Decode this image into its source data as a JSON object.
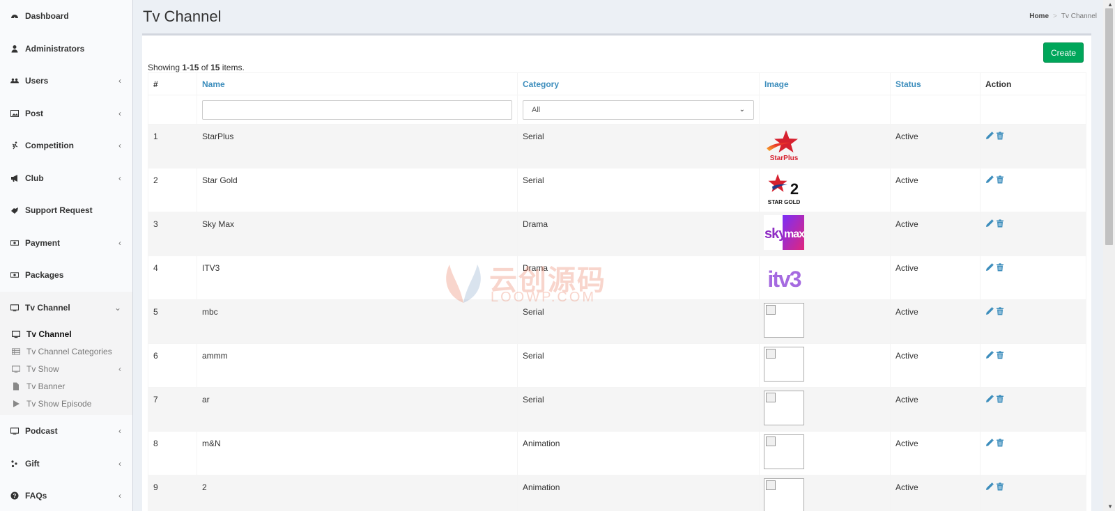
{
  "sidebar": {
    "items": [
      {
        "label": "Dashboard",
        "icon": "dashboard-icon",
        "chevron": ""
      },
      {
        "label": "Administrators",
        "icon": "user-icon",
        "chevron": ""
      },
      {
        "label": "Users",
        "icon": "users-icon",
        "chevron": "‹"
      },
      {
        "label": "Post",
        "icon": "picture-icon",
        "chevron": "‹"
      },
      {
        "label": "Competition",
        "icon": "running-icon",
        "chevron": "‹"
      },
      {
        "label": "Club",
        "icon": "bullhorn-icon",
        "chevron": "‹"
      },
      {
        "label": "Support Request",
        "icon": "handshake-icon",
        "chevron": ""
      },
      {
        "label": "Payment",
        "icon": "money-icon",
        "chevron": "‹"
      },
      {
        "label": "Packages",
        "icon": "money-icon",
        "chevron": ""
      },
      {
        "label": "Tv Channel",
        "icon": "tv-icon",
        "chevron": "⌄"
      },
      {
        "label": "Podcast",
        "icon": "tv-icon",
        "chevron": "‹"
      },
      {
        "label": "Gift",
        "icon": "gift-icon",
        "chevron": "‹"
      },
      {
        "label": "FAQs",
        "icon": "question-icon",
        "chevron": "‹"
      }
    ],
    "tv_submenu": [
      {
        "label": "Tv Channel",
        "icon": "tv-icon"
      },
      {
        "label": "Tv Channel Categories",
        "icon": "list-icon"
      },
      {
        "label": "Tv Show",
        "icon": "tv-icon",
        "chevron": "‹"
      },
      {
        "label": "Tv Banner",
        "icon": "file-icon"
      },
      {
        "label": "Tv Show Episode",
        "icon": "play-icon"
      }
    ]
  },
  "header": {
    "title": "Tv Channel",
    "breadcrumb_home": "Home",
    "breadcrumb_sep": ">",
    "breadcrumb_current": "Tv Channel"
  },
  "toolbar": {
    "create_label": "Create"
  },
  "summary": {
    "prefix": "Showing ",
    "range": "1-15",
    "of": " of ",
    "total": "15",
    "suffix": " items."
  },
  "table": {
    "columns": [
      "#",
      "Name",
      "Category",
      "Image",
      "Status",
      "Action"
    ],
    "filters": {
      "name_value": "",
      "category_value": "All"
    },
    "rows": [
      {
        "num": "1",
        "name": "StarPlus",
        "category": "Serial",
        "image": "starplus",
        "status": "Active"
      },
      {
        "num": "2",
        "name": "Star Gold",
        "category": "Serial",
        "image": "stargold",
        "status": "Active"
      },
      {
        "num": "3",
        "name": "Sky Max",
        "category": "Drama",
        "image": "skymax",
        "status": "Active"
      },
      {
        "num": "4",
        "name": "ITV3",
        "category": "Drama",
        "image": "itv3",
        "status": "Active"
      },
      {
        "num": "5",
        "name": "mbc",
        "category": "Serial",
        "image": "broken",
        "status": "Active"
      },
      {
        "num": "6",
        "name": "ammm",
        "category": "Serial",
        "image": "broken",
        "status": "Active"
      },
      {
        "num": "7",
        "name": "ar",
        "category": "Serial",
        "image": "broken",
        "status": "Active"
      },
      {
        "num": "8",
        "name": "m&N",
        "category": "Animation",
        "image": "broken",
        "status": "Active"
      },
      {
        "num": "9",
        "name": "2",
        "category": "Animation",
        "image": "broken",
        "status": "Active"
      }
    ]
  },
  "logos": {
    "starplus_text": "StarPlus",
    "stargold_text": "STAR GOLD",
    "stargold_num": "2",
    "skymax_sky": "sky",
    "skymax_max": "max",
    "itv3_text": "itv3"
  },
  "watermark": {
    "cn": "云创源码",
    "en": "LOOWP.COM"
  },
  "colors": {
    "accent": "#3c8dbc",
    "create": "#00a65a",
    "sky_purple": "#8e2cc4",
    "itv_purple": "#a56ae0",
    "star_red": "#d6202e"
  }
}
